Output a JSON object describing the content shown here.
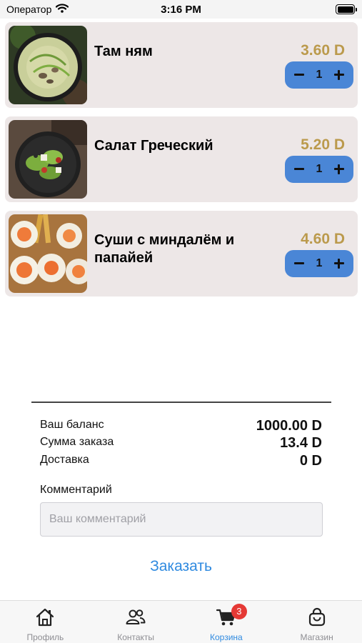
{
  "status_bar": {
    "carrier": "Оператор",
    "time": "3:16 PM"
  },
  "cart": {
    "items": [
      {
        "name": "Там ням",
        "price": "3.60 D",
        "quantity": "1",
        "image": "soup-photo"
      },
      {
        "name": "Салат Греческий",
        "price": "5.20 D",
        "quantity": "1",
        "image": "salad-photo"
      },
      {
        "name": "Суши с миндалём и папайей",
        "price": "4.60 D",
        "quantity": "1",
        "image": "sushi-photo"
      }
    ]
  },
  "summary": {
    "balance_label": "Ваш баланс",
    "balance_value": "1000.00 D",
    "order_sum_label": "Сумма заказа",
    "order_sum_value": "13.4 D",
    "delivery_label": "Доставка",
    "delivery_value": "0 D"
  },
  "comment": {
    "label": "Комментарий",
    "placeholder": "Ваш комментарий",
    "value": ""
  },
  "order_button": "Заказать",
  "tab_bar": {
    "tabs": [
      {
        "label": "Профиль",
        "icon": "home-icon"
      },
      {
        "label": "Контакты",
        "icon": "people-icon"
      },
      {
        "label": "Корзина",
        "icon": "cart-icon",
        "badge": "3",
        "active": true
      },
      {
        "label": "Магазин",
        "icon": "bag-icon"
      }
    ]
  },
  "colors": {
    "accent": "#2f8ae0",
    "stepper": "#4a86d6",
    "price": "#bb9a4c",
    "card": "#ede7e7",
    "badge": "#e53935"
  }
}
